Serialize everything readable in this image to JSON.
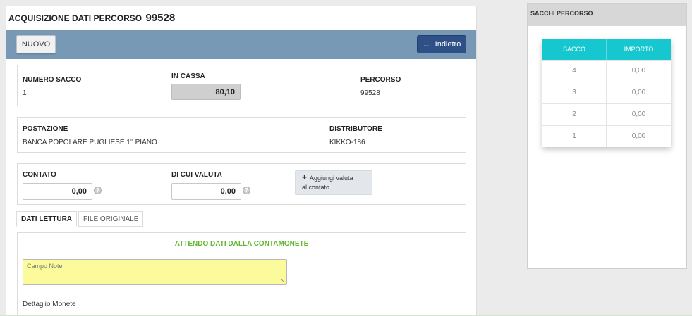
{
  "header": {
    "title": "ACQUISIZIONE DATI PERCORSO",
    "number": "99528"
  },
  "toolbar": {
    "new_label": "NUOVO",
    "back_label": "Indietro",
    "back_icon": "arrow-left-icon",
    "accent": "#7899b6"
  },
  "info": {
    "numero_sacco_label": "NUMERO SACCO",
    "numero_sacco_value": "1",
    "in_cassa_label": "IN CASSA",
    "in_cassa_value": "80,10",
    "percorso_label": "PERCORSO",
    "percorso_value": "99528"
  },
  "location": {
    "postazione_label": "POSTAZIONE",
    "postazione_value": "BANCA POPOLARE PUGLIESE 1° PIANO",
    "distributore_label": "DISTRIBUTORE",
    "distributore_value": "KIKKO-186"
  },
  "cash": {
    "contato_label": "CONTATO",
    "contato_value": "0,00",
    "valuta_label": "DI CUI VALUTA",
    "valuta_value": "0,00",
    "add_line1": "Aggiungi valuta",
    "add_line2": "al contato",
    "help_icon": "question-icon"
  },
  "tabs": [
    {
      "label": "DATI LETTURA",
      "active": true
    },
    {
      "label": "FILE ORIGINALE",
      "active": false
    }
  ],
  "content": {
    "waiting_text": "ATTENDO DATI DALLA CONTAMONETE",
    "waiting_color": "#62b530",
    "notes_placeholder": "Campo Note",
    "notes_color": "#fbfb9b",
    "dettaglio_label": "Dettaglio Monete"
  },
  "side": {
    "title": "SACCHI PERCORSO",
    "columns": [
      "SACCO",
      "IMPORTO"
    ],
    "header_color": "#17c7cf",
    "rows": [
      [
        "4",
        "0,00"
      ],
      [
        "3",
        "0,00"
      ],
      [
        "2",
        "0,00"
      ],
      [
        "1",
        "0,00"
      ]
    ]
  }
}
